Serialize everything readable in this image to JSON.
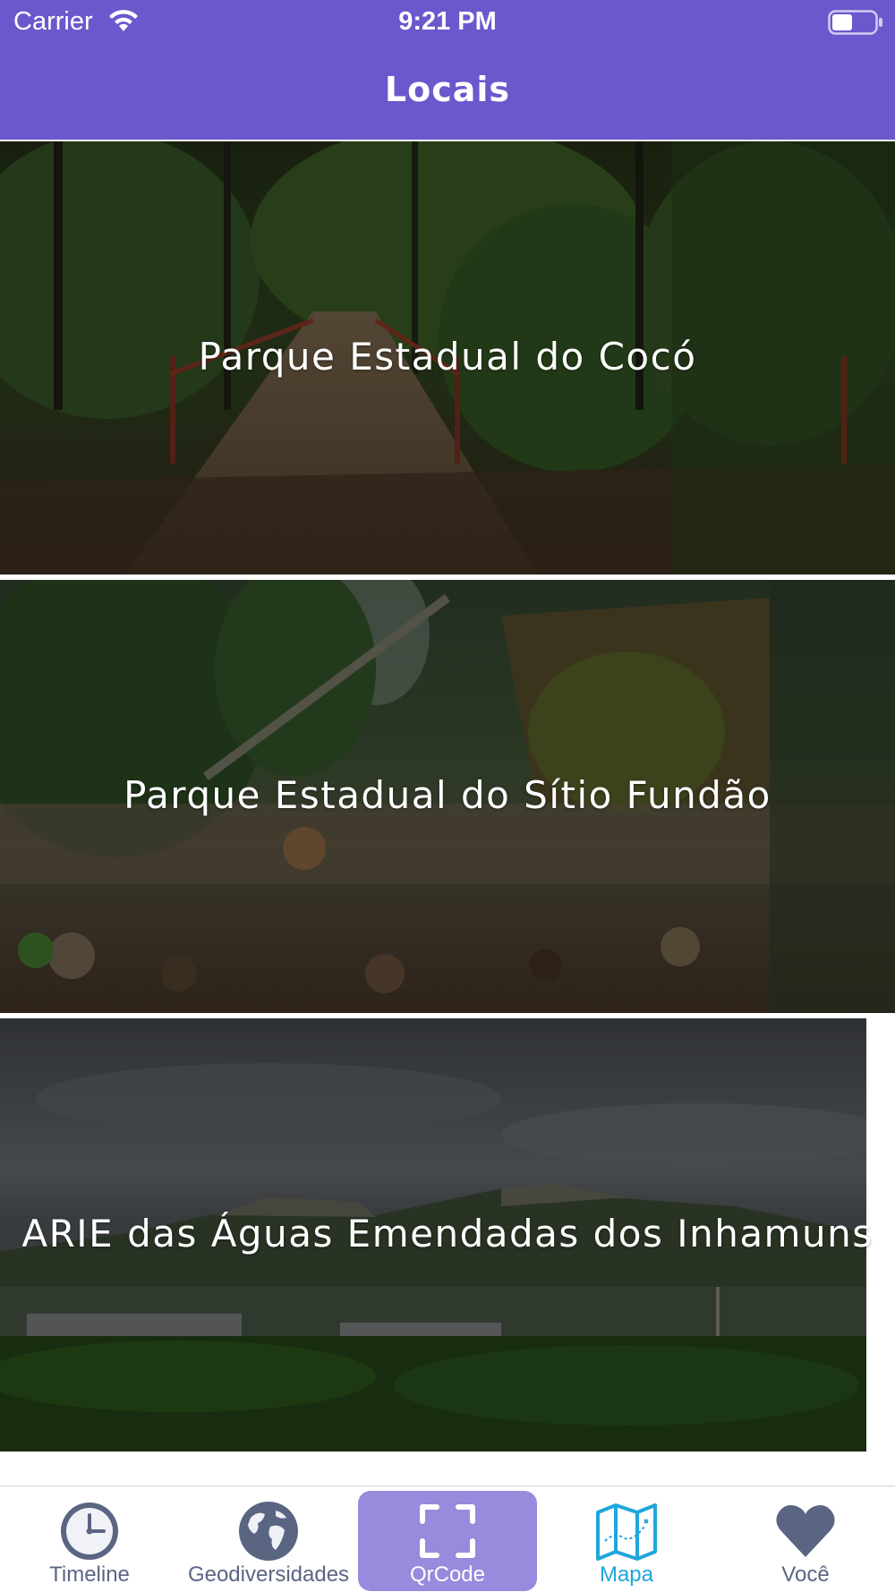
{
  "status_bar": {
    "carrier": "Carrier",
    "time": "9:21 PM",
    "wifi_icon": "wifi-icon",
    "battery_icon": "battery-icon"
  },
  "header": {
    "title": "Locais",
    "background_color": "#6a58cc"
  },
  "locations": [
    {
      "name": "Parque Estadual do Cocó",
      "image": "forest-bridge-photo"
    },
    {
      "name": "Parque Estadual do Sítio Fundão",
      "image": "forest-stream-photo"
    },
    {
      "name": "ARIE das Águas Emendadas dos Inhamuns",
      "image": "mountain-landscape-photo"
    }
  ],
  "tabbar": {
    "tabs": [
      {
        "label": "Timeline",
        "icon": "clock-icon",
        "active": false
      },
      {
        "label": "Geodiversidades",
        "icon": "globe-icon",
        "active": false
      },
      {
        "label": "QrCode",
        "icon": "qr-scan-icon",
        "active": true,
        "highlight": true
      },
      {
        "label": "Mapa",
        "icon": "map-icon",
        "active": false
      },
      {
        "label": "Você",
        "icon": "heart-icon",
        "active": false
      }
    ],
    "colors": {
      "default": "#5a6582",
      "highlight_bg": "#968bdc",
      "map": "#1fa6dc"
    }
  }
}
